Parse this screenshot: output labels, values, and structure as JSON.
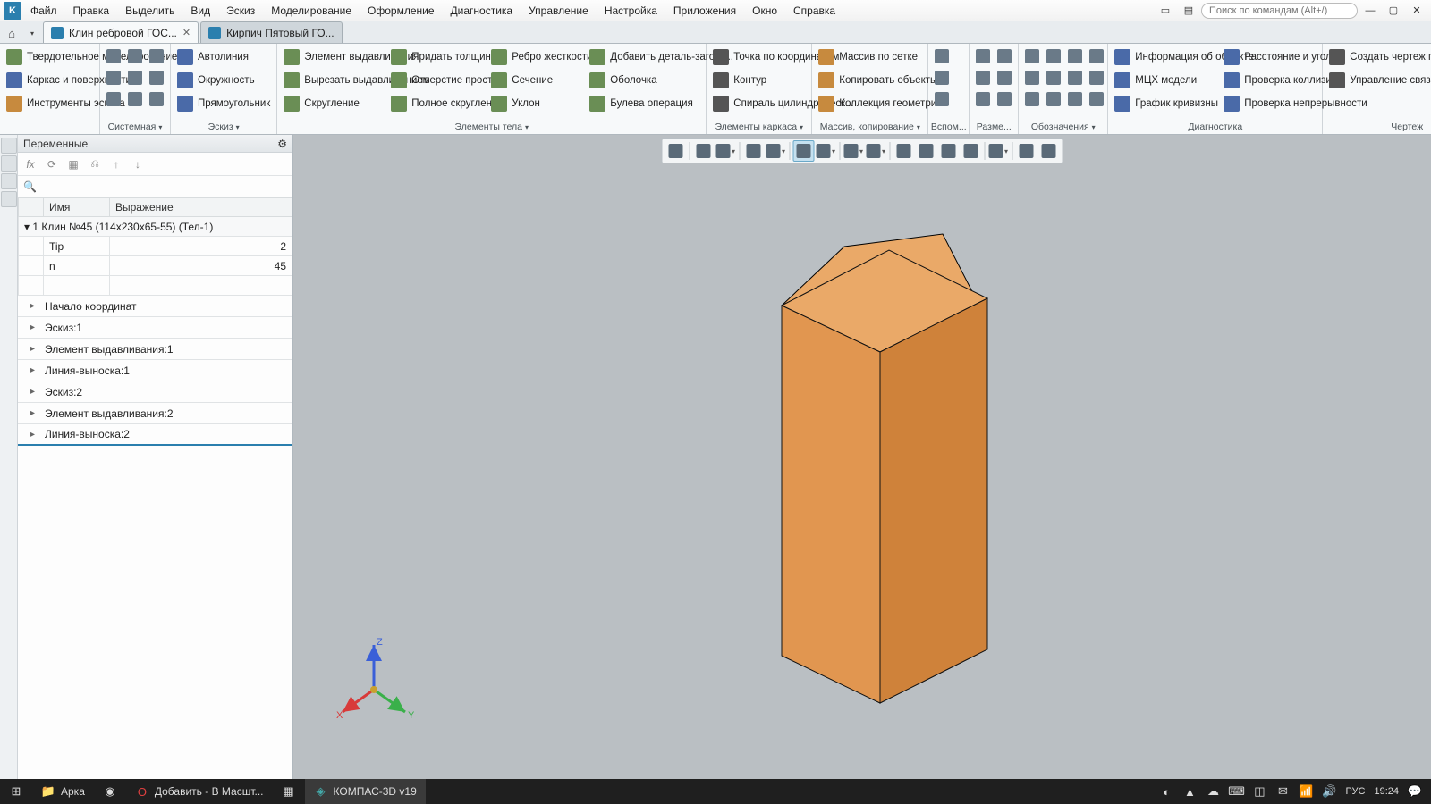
{
  "menu": {
    "items": [
      "Файл",
      "Правка",
      "Выделить",
      "Вид",
      "Эскиз",
      "Моделирование",
      "Оформление",
      "Диагностика",
      "Управление",
      "Настройка",
      "Приложения",
      "Окно",
      "Справка"
    ],
    "search_placeholder": "Поиск по командам (Alt+/)"
  },
  "tabs": {
    "active": "Клин ребровой ГОС...",
    "inactive": "Кирпич Пятовый ГО..."
  },
  "ribbon": {
    "g1": {
      "label": "",
      "big1": "Твердотельное моделирование",
      "r1": "Каркас и поверхности",
      "r2": "Инструменты эскиза"
    },
    "sys": {
      "label": "Системная"
    },
    "sketch": {
      "label": "Эскиз",
      "b1": "Автолиния",
      "b2": "Окружность",
      "b3": "Прямоугольник"
    },
    "body": {
      "label": "Элементы тела",
      "c1a": "Элемент выдавливания",
      "c1b": "Вырезать выдавливанием",
      "c1c": "Скругление",
      "c2a": "Придать толщину",
      "c2b": "Отверстие простое",
      "c2c": "Полное скругление",
      "c3a": "Ребро жесткости",
      "c3b": "Сечение",
      "c3c": "Уклон",
      "c4a": "Добавить деталь-загото...",
      "c4b": "Оболочка",
      "c4c": "Булева операция"
    },
    "frame": {
      "label": "Элементы каркаса",
      "b1": "Точка по координатам",
      "b2": "Контур",
      "b3": "Спираль цилиндрическ..."
    },
    "arr": {
      "label": "Массив, копирование",
      "b1": "Массив по сетке",
      "b2": "Копировать объекты",
      "b3": "Коллекция геометрии"
    },
    "aux": {
      "label": "Вспом..."
    },
    "dim": {
      "label": "Разме..."
    },
    "ann": {
      "label": "Обозначения"
    },
    "diag": {
      "label": "Диагностика",
      "b1": "Информация об объекте",
      "b2": "МЦХ модели",
      "b3": "График кривизны",
      "c1": "Расстояние и угол",
      "c2": "Проверка коллизий",
      "c3": "Проверка непрерывности"
    },
    "drw": {
      "label": "Чертеж",
      "b1": "Создать чертеж по модели",
      "b2": "Управление связанными ч..."
    }
  },
  "panel": {
    "title": "Переменные",
    "col_name": "Имя",
    "col_expr": "Выражение",
    "root": "1 Клин №45 (114х230х65-55) (Тел-1)",
    "rows": [
      {
        "n": "Tip",
        "v": "2"
      },
      {
        "n": "n",
        "v": "45"
      }
    ],
    "nodes": [
      "Начало координат",
      "Эскиз:1",
      "Элемент выдавливания:1",
      "Линия-выноска:1",
      "Эскиз:2",
      "Элемент выдавливания:2",
      "Линия-выноска:2"
    ]
  },
  "axes": {
    "x": "X",
    "y": "Y",
    "z": "Z"
  },
  "taskbar": {
    "folder": "Арка",
    "opera": "Добавить - В Масшт...",
    "app": "КОМПАС-3D v19",
    "lang": "РУС",
    "time": "19:24"
  }
}
